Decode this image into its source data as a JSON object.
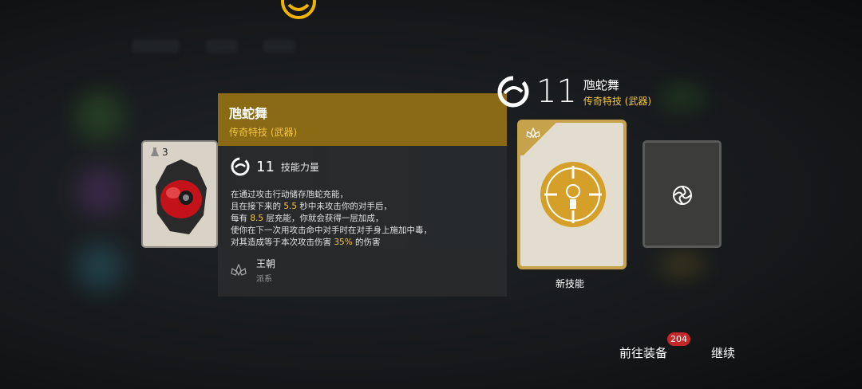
{
  "tooltip": {
    "title": "虺蛇舞",
    "subtitle": "传奇特技 (武器)",
    "stat_value": "11",
    "stat_label": "技能力量",
    "desc": {
      "l1": "在通过攻击行动储存虺蛇充能，",
      "l2a": "且在接下来的 ",
      "l2b": "5.5",
      "l2c": " 秒中未攻击你的对手后，",
      "l3a": "每有 ",
      "l3b": "8.5",
      "l3c": " 层充能，你就会获得一层加成，",
      "l4": "使你在下一次用攻击命中对手时在对手身上施加中毒，",
      "l5a": "对其造成等于本次攻击伤害 ",
      "l5b": "35%",
      "l5c": " 的伤害"
    },
    "dynasty_name": "王朝",
    "dynasty_sub": "派系"
  },
  "left_card": {
    "count": "3"
  },
  "header": {
    "value": "11",
    "name": "虺蛇舞",
    "type": "传奇特技 (武器)"
  },
  "new_skill_label": "新技能",
  "actions": {
    "go_equip": "前往装备",
    "badge": "204",
    "continue": "继续"
  },
  "colors": {
    "gold": "#f3c542",
    "header_bg": "#8a6a14",
    "badge": "#c22828"
  }
}
